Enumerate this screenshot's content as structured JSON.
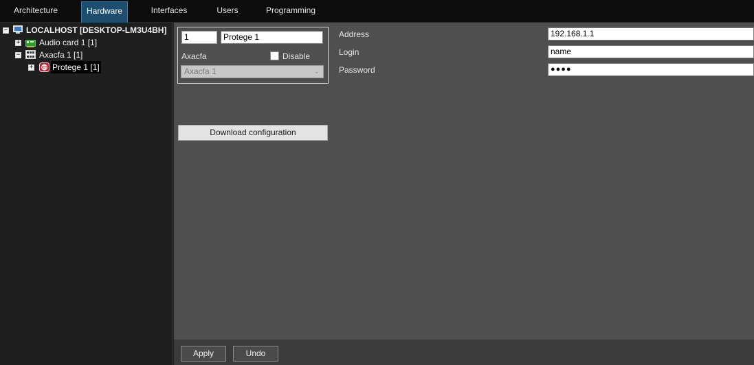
{
  "tabs": [
    {
      "label": "Architecture"
    },
    {
      "label": "Hardware"
    },
    {
      "label": "Interfaces"
    },
    {
      "label": "Users"
    },
    {
      "label": "Programming"
    }
  ],
  "active_tab": "Hardware",
  "tree": {
    "root": {
      "label": "LOCALHOST [DESKTOP-LM3U4BH]",
      "expander": "−"
    },
    "audio": {
      "label": "Audio card 1 [1]",
      "expander": "+"
    },
    "axacfa": {
      "label": "Axacfa 1 [1]",
      "expander": "−"
    },
    "protege": {
      "label": "Protege 1 [1]",
      "expander": "+",
      "icon_text": "ICT"
    }
  },
  "object": {
    "id_value": "1",
    "name_value": "Protege 1",
    "parent_label": "Axacfa",
    "disable_label": "Disable",
    "disable_checked": false,
    "parent_select_value": "Axacfa 1",
    "download_button": "Download configuration"
  },
  "settings": {
    "address_label": "Address",
    "address_value": "192.168.1.1",
    "login_label": "Login",
    "login_value": "name",
    "password_label": "Password",
    "password_value": "●●●●"
  },
  "footer": {
    "apply_label": "Apply",
    "undo_label": "Undo"
  },
  "colors": {
    "active_tab": "#1d4e6e",
    "panel": "#4f4f4f",
    "tree_bg": "#1f1f1f",
    "tabbar_bg": "#0c0c0c"
  }
}
